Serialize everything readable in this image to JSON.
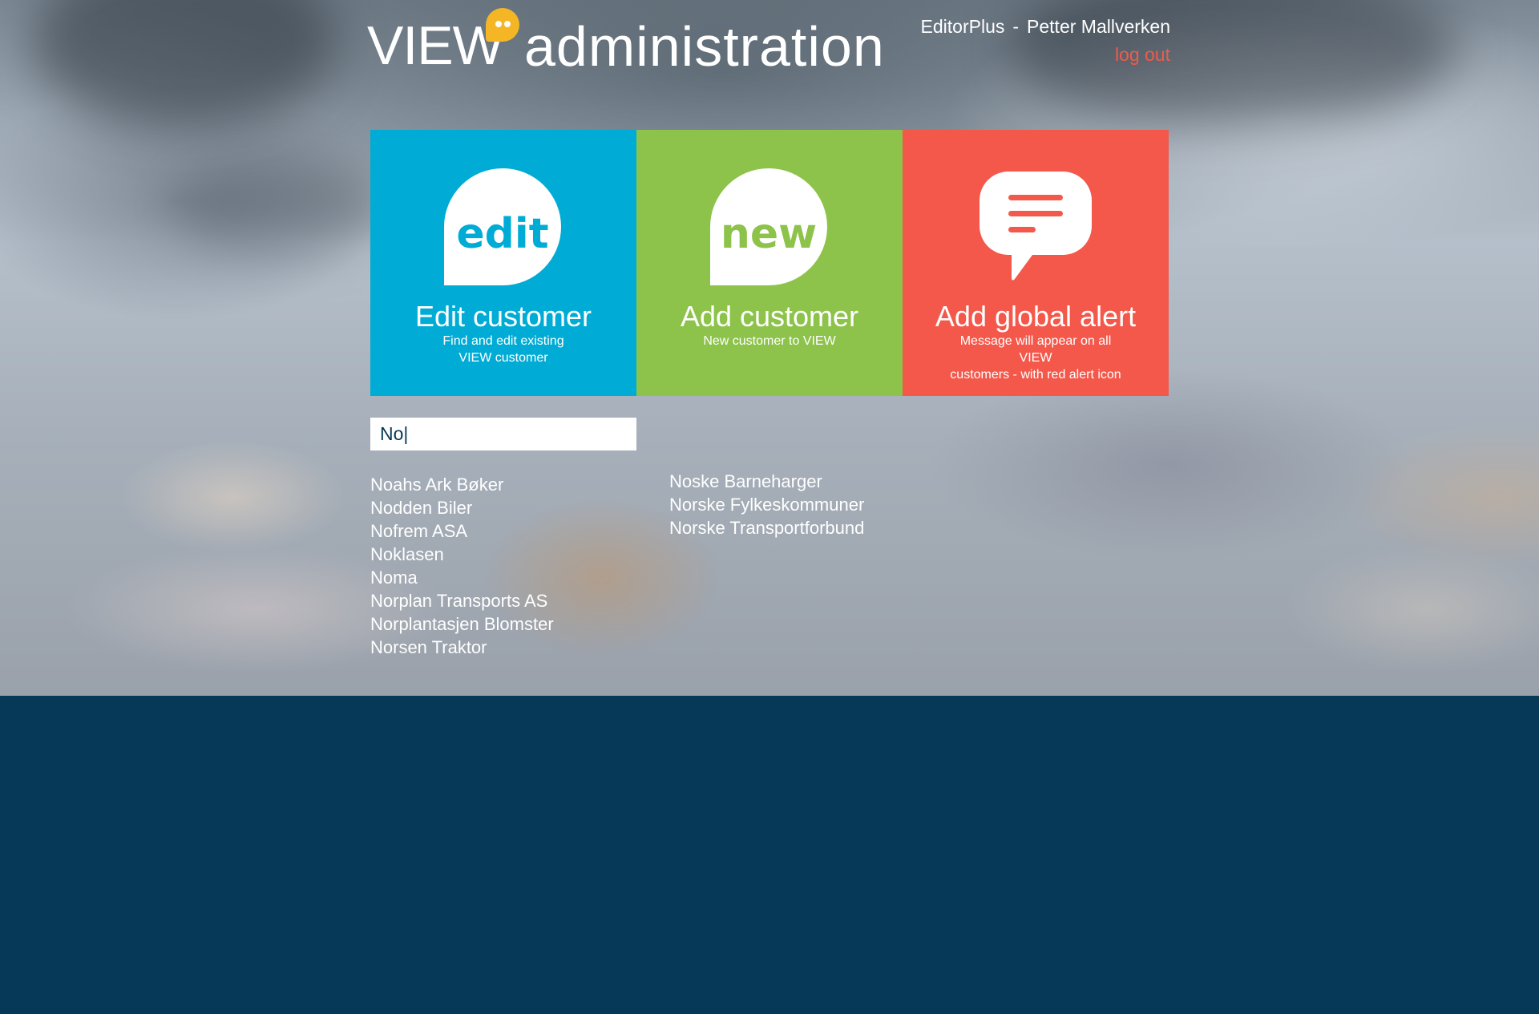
{
  "brand": {
    "view": "VIEW",
    "admin": "administration"
  },
  "user": {
    "role": "EditorPlus",
    "separator": "-",
    "name": "Petter Mallverken",
    "logout": "log out"
  },
  "tiles": [
    {
      "icon_text": "edit",
      "title": "Edit customer",
      "subtitle_line1": "Find and edit existing",
      "subtitle_line2": "VIEW customer",
      "color": "#00acd5"
    },
    {
      "icon_text": "new",
      "title": "Add customer",
      "subtitle_line1": "New customer to VIEW",
      "subtitle_line2": "",
      "color": "#8dc34a"
    },
    {
      "icon": "message-alert-icon",
      "title": "Add global alert",
      "subtitle_line1": "Message will appear on all VIEW",
      "subtitle_line2": "customers - with red alert icon",
      "color": "#f4584b"
    }
  ],
  "search": {
    "value": "No|"
  },
  "results_left": [
    "Noahs Ark Bøker",
    "Nodden Biler",
    "Nofrem ASA",
    "Noklasen",
    "Noma",
    "Norplan Transports AS",
    "Norplantasjen Blomster",
    "Norsen Traktor"
  ],
  "results_right": [
    "Noske Barneharger",
    "Norske Fylkeskommuner",
    "Norske Transportforbund"
  ],
  "colors": {
    "footer_bg": "#063857",
    "logout": "#f25a4a",
    "brand_dot": "#f4b625"
  }
}
